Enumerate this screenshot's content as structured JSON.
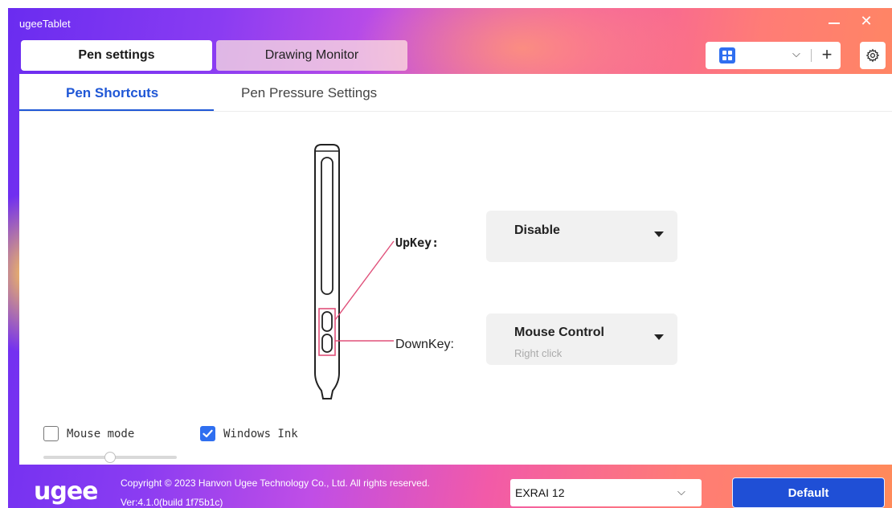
{
  "window": {
    "title": "ugeeTablet",
    "minimize_icon": "minimize-icon",
    "close_glyph": "✕"
  },
  "top_tabs": [
    {
      "label": "Pen settings",
      "active": true
    },
    {
      "label": "Drawing Monitor",
      "active": false
    }
  ],
  "device_bar": {
    "device_icon": "grid-icon",
    "chevron": "⌵",
    "add_glyph": "+",
    "settings_icon": "gear-icon"
  },
  "sub_tabs": [
    {
      "label": "Pen Shortcuts",
      "active": true
    },
    {
      "label": "Pen Pressure Settings",
      "active": false
    }
  ],
  "pen_keys": {
    "upkey": {
      "label": "UpKey:",
      "value": "Disable"
    },
    "downkey": {
      "label": "DownKey:",
      "value": "Mouse Control",
      "sub": "Right click"
    }
  },
  "options": {
    "mouse_mode": {
      "label": "Mouse mode",
      "checked": false
    },
    "windows_ink": {
      "label": "Windows Ink",
      "checked": true
    },
    "mouse_speed_slider": {
      "value_fraction": 0.5
    }
  },
  "footer": {
    "logo": "ugee",
    "copyright": "Copyright © 2023 Hanvon Ugee Technology Co., Ltd. All rights reserved.",
    "version": "Ver:4.1.0(build 1f75b1c)",
    "model": "EXRAI 12",
    "model_chevron": "⌵",
    "default_label": "Default"
  },
  "colors": {
    "accent": "#1f57d6",
    "checkbox_checked": "#2f6ff0",
    "pen_key_highlight": "#e0507a",
    "window_gradient": [
      "#6a2cf0",
      "#c04ee6",
      "#f25aa8",
      "#ff8a5a"
    ]
  }
}
